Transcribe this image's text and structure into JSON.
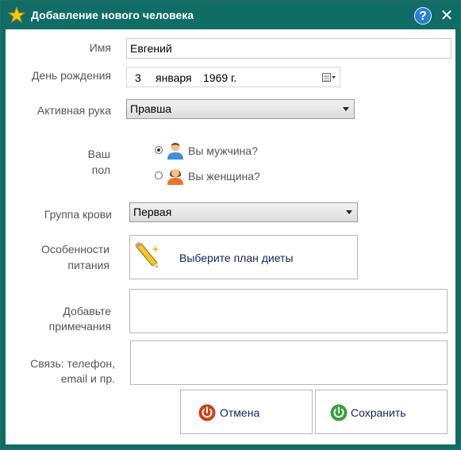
{
  "window": {
    "title": "Добавление нового человека",
    "help_label": "?",
    "close_label": "✕"
  },
  "form": {
    "name": {
      "label": "Имя",
      "value": "Евгений"
    },
    "birthday": {
      "label": "День рождения",
      "day": "3",
      "month": "января",
      "year": "1969 г."
    },
    "hand": {
      "label": "Активная рука",
      "value": "Правша"
    },
    "gender": {
      "label_line1": "Ваш",
      "label_line2": "пол",
      "male": "Вы мужчина?",
      "female": "Вы женщина?",
      "selected": "male"
    },
    "blood": {
      "label": "Группа крови",
      "value": "Первая"
    },
    "diet": {
      "label_line1": "Особенности",
      "label_line2": "питания",
      "button": "Выберите план диеты"
    },
    "notes": {
      "label_line1": "Добавьте",
      "label_line2": "примечания",
      "value": ""
    },
    "contacts": {
      "label_line1": "Связь: телефон,",
      "label_line2": "email и пр.",
      "value": ""
    }
  },
  "actions": {
    "cancel": "Отмена",
    "save": "Сохранить"
  },
  "colors": {
    "titlebar": "#0f6d66",
    "cancel_icon": "#d0401d",
    "save_icon": "#3aa03a"
  }
}
